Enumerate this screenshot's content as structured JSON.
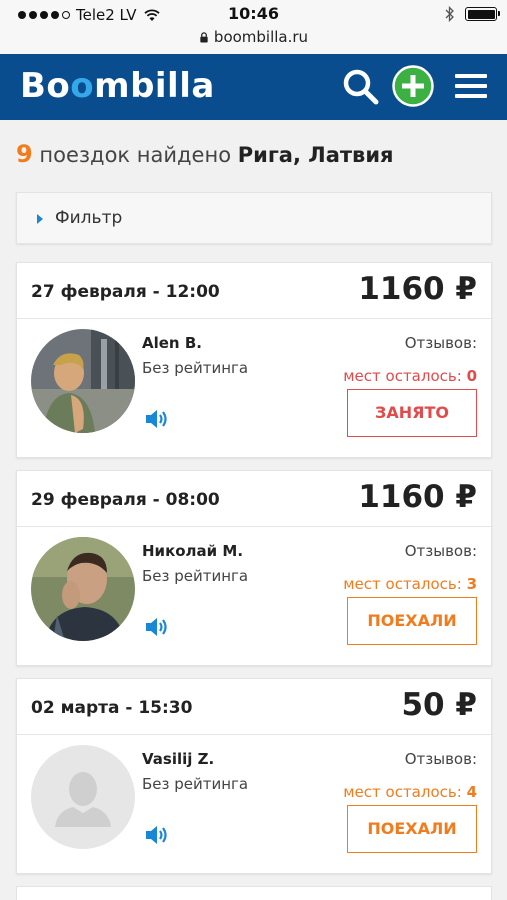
{
  "status_bar": {
    "carrier": "Tele2 LV",
    "time": "10:46",
    "url": "boombilla.ru"
  },
  "header": {
    "logo_part1": "Bo",
    "logo_part2": "o",
    "logo_part3": "mbilla"
  },
  "results": {
    "count": "9",
    "text": "поездок найдено",
    "city": "Рига, Латвия"
  },
  "filter": {
    "label": "Фильтр"
  },
  "trips": [
    {
      "date": "27 февраля - 12:00",
      "price": "1160",
      "currency": "₽",
      "driver": "Alen B.",
      "rating": "Без рейтинга",
      "reviews_label": "Отзывов:",
      "seats_label": "мест осталось:",
      "seats": "0",
      "button": "ЗАНЯТО",
      "status_color": "#e24b4b"
    },
    {
      "date": "29 февраля - 08:00",
      "price": "1160",
      "currency": "₽",
      "driver": "Николай М.",
      "rating": "Без рейтинга",
      "reviews_label": "Отзывов:",
      "seats_label": "мест осталось:",
      "seats": "3",
      "button": "ПОЕХАЛИ",
      "status_color": "#f17c1e"
    },
    {
      "date": "02 марта - 15:30",
      "price": "50",
      "currency": "₽",
      "driver": "Vasilij Z.",
      "rating": "Без рейтинга",
      "reviews_label": "Отзывов:",
      "seats_label": "мест осталось:",
      "seats": "4",
      "button": "ПОЕХАЛИ",
      "status_color": "#f17c1e"
    }
  ],
  "colors": {
    "header_bg": "#0a4d8f",
    "accent_orange": "#f17c1e",
    "accent_green": "#3cb043",
    "busy_red": "#e24b4b",
    "link_blue": "#1a87d6"
  },
  "icons": [
    "signal-dots-icon",
    "wifi-icon",
    "lock-icon",
    "bluetooth-icon",
    "battery-icon",
    "search-icon",
    "add-icon",
    "menu-icon",
    "speaker-icon",
    "avatar-placeholder-icon"
  ]
}
